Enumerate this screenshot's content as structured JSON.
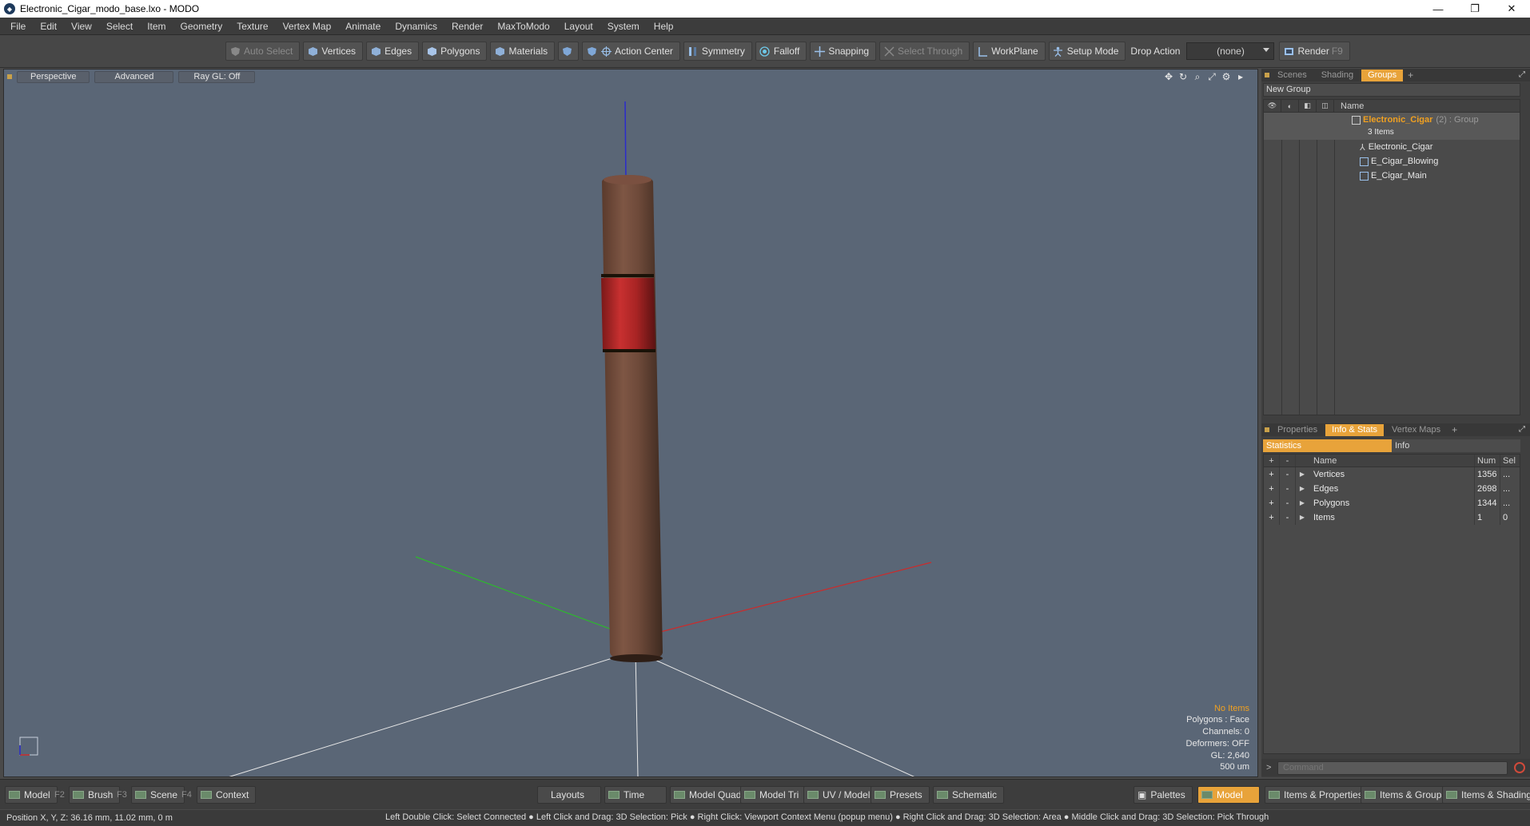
{
  "window": {
    "title": "Electronic_Cigar_modo_base.lxo - MODO",
    "controls": [
      "—",
      "❐",
      "✕"
    ]
  },
  "menu": [
    "File",
    "Edit",
    "View",
    "Select",
    "Item",
    "Geometry",
    "Texture",
    "Vertex Map",
    "Animate",
    "Dynamics",
    "Render",
    "MaxToModo",
    "Layout",
    "System",
    "Help"
  ],
  "toolbar": {
    "auto_select": "Auto Select",
    "vertices": "Vertices",
    "edges": "Edges",
    "polygons": "Polygons",
    "materials": "Materials",
    "action_center": "Action Center",
    "symmetry": "Symmetry",
    "falloff": "Falloff",
    "snapping": "Snapping",
    "select_through": "Select Through",
    "workplane": "WorkPlane",
    "setup_mode": "Setup Mode",
    "drop_action_label": "Drop Action",
    "drop_action_value": "(none)",
    "render": "Render",
    "render_key": "F9"
  },
  "viewport": {
    "tabs": [
      "Perspective",
      "Advanced",
      "Ray GL: Off"
    ],
    "info": {
      "items": "No Items",
      "polygons": "Polygons : Face",
      "channels": "Channels: 0",
      "deformers": "Deformers: OFF",
      "gl": "GL: 2,640",
      "scale": "500 um"
    }
  },
  "groups_panel": {
    "tabs": [
      "Scenes",
      "Shading",
      "Groups"
    ],
    "active_tab": "Groups",
    "new_group": "New Group",
    "column_name": "Name",
    "group": {
      "name": "Electronic_Cigar",
      "suffix": "(2) : Group",
      "count": "3 Items"
    },
    "items": [
      "Electronic_Cigar",
      "E_Cigar_Blowing",
      "E_Cigar_Main"
    ]
  },
  "stats_panel": {
    "tabs": [
      "Properties",
      "Info & Stats",
      "Vertex Maps"
    ],
    "active_tab": "Info & Stats",
    "subtabs": [
      "Statistics",
      "Info"
    ],
    "headers": {
      "plus": "+",
      "minus": "-",
      "name": "Name",
      "num": "Num",
      "sel": "Sel"
    },
    "rows": [
      {
        "name": "Vertices",
        "num": "1356",
        "sel": "..."
      },
      {
        "name": "Edges",
        "num": "2698",
        "sel": "..."
      },
      {
        "name": "Polygons",
        "num": "1344",
        "sel": "..."
      },
      {
        "name": "Items",
        "num": "1",
        "sel": "0"
      }
    ],
    "command_placeholder": "Command"
  },
  "bottombar": {
    "left": [
      {
        "label": "Model",
        "key": "F2"
      },
      {
        "label": "Brush",
        "key": "F3"
      },
      {
        "label": "Scene",
        "key": "F4"
      },
      {
        "label": "Context",
        "key": ""
      }
    ],
    "center": [
      "Layouts",
      "Time",
      "Model Quad",
      "Model Tri",
      "UV / Model",
      "Presets",
      "Schematic"
    ],
    "right": [
      "Palettes",
      "Model",
      "Items & Properties",
      "Items & Groups",
      "Items & Shading"
    ]
  },
  "status": {
    "position": "Position X, Y, Z:   36.16 mm, 11.02 mm, 0 m",
    "hints": "Left Double Click: Select Connected ● Left Click and Drag: 3D Selection: Pick ● Right Click: Viewport Context Menu (popup menu) ● Right Click and Drag: 3D Selection: Area ● Middle Click and Drag: 3D Selection: Pick Through"
  },
  "colors": {
    "accent": "#e8a33a",
    "viewport_bg": "#5a6676",
    "cigar_brown": "#6e4a3a",
    "band_red": "#b82a2a",
    "axis_x": "#cc2b2b",
    "axis_y": "#2db82d",
    "axis_z": "#2b2bcc"
  }
}
